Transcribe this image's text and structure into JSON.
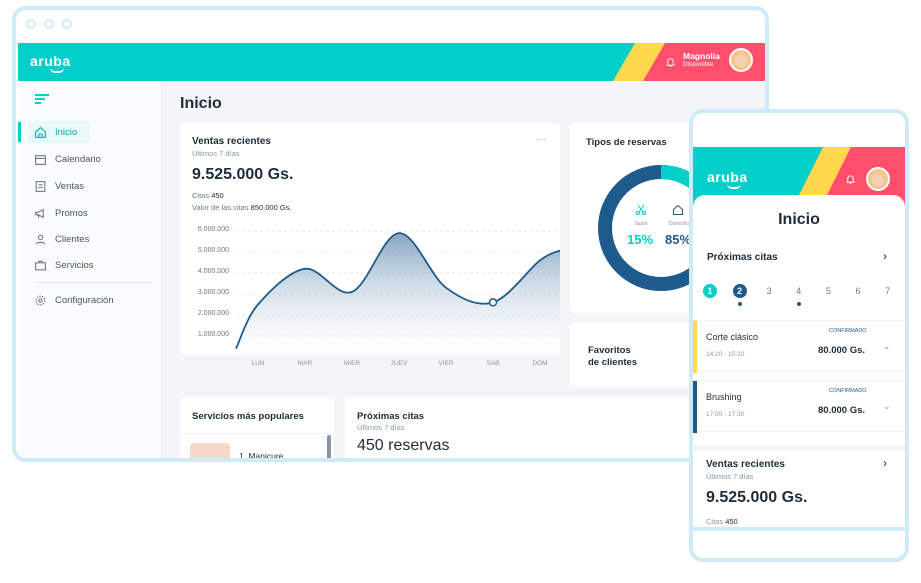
{
  "brand": {
    "logo": "aruba",
    "accent": "#02cfc9",
    "pink": "#ff4f6d",
    "yellow": "#ffd84d",
    "navy": "#1f5a8c"
  },
  "user": {
    "name": "Magnolia",
    "status": "Disponible"
  },
  "sidebar": {
    "items": [
      {
        "label": "Inicio",
        "icon": "home-icon",
        "active": true
      },
      {
        "label": "Calendario",
        "icon": "calendar-icon"
      },
      {
        "label": "Ventas",
        "icon": "receipt-icon"
      },
      {
        "label": "Promos",
        "icon": "megaphone-icon"
      },
      {
        "label": "Clientes",
        "icon": "user-icon"
      },
      {
        "label": "Servicios",
        "icon": "briefcase-icon"
      },
      {
        "label": "Configuración",
        "icon": "gear-icon"
      }
    ]
  },
  "page": {
    "title": "Inicio"
  },
  "sales": {
    "title": "Ventas recientes",
    "subtitle": "Últimos 7 días",
    "total": "9.525.000 Gs.",
    "citas_label": "Citas",
    "citas_value": "450",
    "valor_label": "Valor de las citas",
    "valor_value": "850.000 Gs.",
    "more": "···"
  },
  "chart_data": {
    "type": "area",
    "x": [
      "LUN",
      "MAR",
      "MIER",
      "JUEV",
      "VIER",
      "SAB",
      "DOM"
    ],
    "values": [
      2500000,
      4200000,
      3100000,
      5900000,
      3300000,
      2600000,
      4600000
    ],
    "yticks": [
      "6.000.000",
      "5.000.000",
      "4.000.000",
      "3.000.000",
      "2.000.000",
      "1.000.000"
    ],
    "ylim": [
      0,
      6000000
    ],
    "grid": true,
    "line_color": "#1f5a8c"
  },
  "reservations": {
    "title": "Tipos de reservas",
    "salon_label": "Salon",
    "salon_pct": "15%",
    "domicilio_label": "Domicilio",
    "domicilio_pct": "85%",
    "salon_share": 0.15
  },
  "favorites": {
    "line1": "Favoritos",
    "line2": "de clientes"
  },
  "popular": {
    "title": "Servicios más populares",
    "item1": "1. Manicure"
  },
  "upcoming_desktop": {
    "title": "Próximas citas",
    "subtitle": "Últimos 7 días",
    "count": "450 reservas"
  },
  "mobile": {
    "title": "Inicio",
    "upcoming_title": "Próximas citas",
    "days": [
      "1",
      "2",
      "3",
      "4",
      "5",
      "6",
      "7"
    ],
    "appointments": [
      {
        "service": "Corte clásico",
        "time": "14:20 - 15:20",
        "status": "CONFIRMADO",
        "price": "80.000 Gs.",
        "color": "#ffd84d"
      },
      {
        "service": "Brushing",
        "time": "17:00 - 17:30",
        "status": "CONFIRMADO",
        "price": "80.000 Gs.",
        "color": "#1f5a8c"
      }
    ],
    "sales_title": "Ventas recientes",
    "sales_subtitle": "Últimos 7 días",
    "sales_total": "9.525.000 Gs.",
    "citas_label": "Citas",
    "citas_value": "450"
  }
}
